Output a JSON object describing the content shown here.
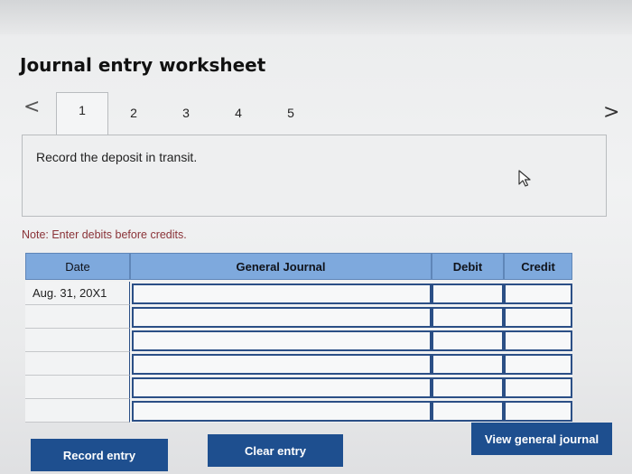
{
  "worksheet": {
    "title": "Journal entry worksheet",
    "tabs": [
      "1",
      "2",
      "3",
      "4",
      "5"
    ],
    "active_tab": "1",
    "prev_label": "<",
    "next_label": ">"
  },
  "instruction": "Record the deposit in transit.",
  "note": "Note: Enter debits before credits.",
  "journal": {
    "headers": {
      "date": "Date",
      "general_journal": "General Journal",
      "debit": "Debit",
      "credit": "Credit"
    },
    "rows": [
      {
        "date": "Aug. 31, 20X1",
        "account": "",
        "debit": "",
        "credit": ""
      },
      {
        "date": "",
        "account": "",
        "debit": "",
        "credit": ""
      },
      {
        "date": "",
        "account": "",
        "debit": "",
        "credit": ""
      },
      {
        "date": "",
        "account": "",
        "debit": "",
        "credit": ""
      },
      {
        "date": "",
        "account": "",
        "debit": "",
        "credit": ""
      },
      {
        "date": "",
        "account": "",
        "debit": "",
        "credit": ""
      }
    ]
  },
  "buttons": {
    "record": "Record entry",
    "clear": "Clear entry",
    "view": "View general journal"
  },
  "icons": {
    "cursor": "mouse-pointer-icon"
  }
}
